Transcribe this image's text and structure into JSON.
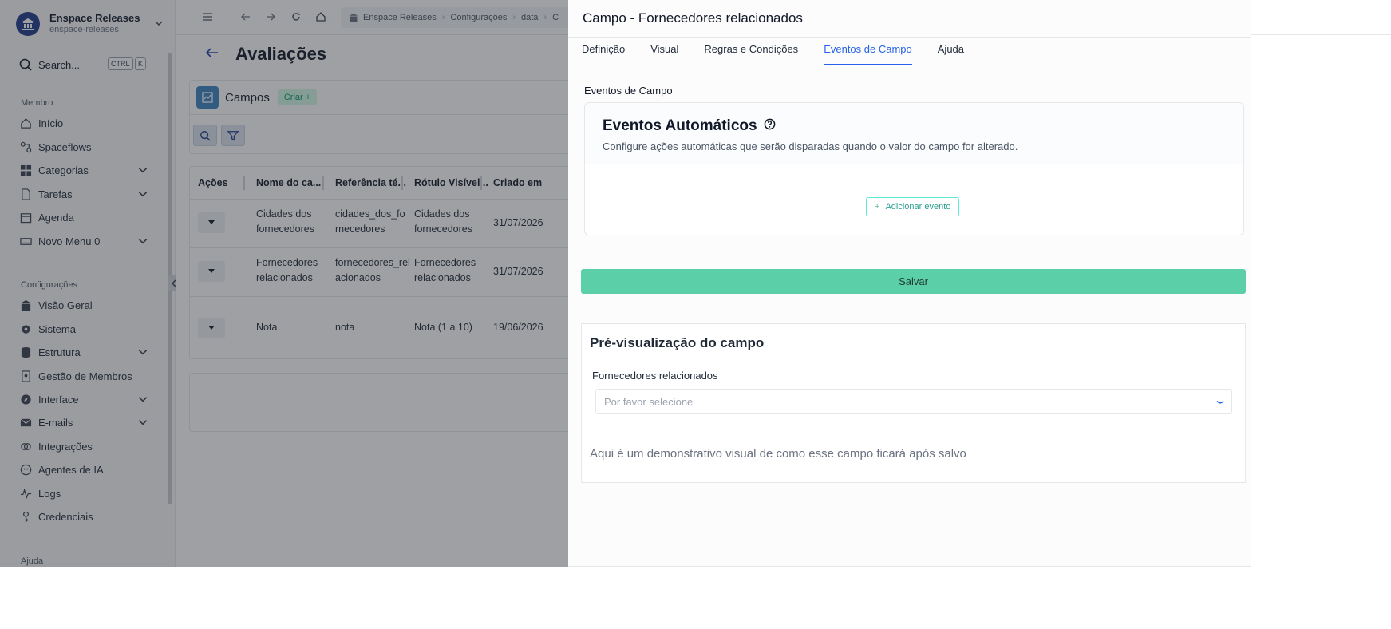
{
  "workspace": {
    "name": "Enspace Releases",
    "slug": "enspace-releases"
  },
  "search": {
    "label": "Search...",
    "kbd1": "CTRL",
    "kbd2": "K"
  },
  "sidebar": {
    "member_label": "Membro",
    "member_items": [
      {
        "label": "Início"
      },
      {
        "label": "Spaceflows"
      },
      {
        "label": "Categorias"
      },
      {
        "label": "Tarefas"
      },
      {
        "label": "Agenda"
      },
      {
        "label": "Novo Menu 0"
      }
    ],
    "config_label": "Configurações",
    "config_items": [
      {
        "label": "Visão Geral"
      },
      {
        "label": "Sistema"
      },
      {
        "label": "Estrutura"
      },
      {
        "label": "Gestão de Membros"
      },
      {
        "label": "Interface"
      },
      {
        "label": "E-mails"
      },
      {
        "label": "Integrações"
      },
      {
        "label": "Agentes de IA"
      },
      {
        "label": "Logs"
      },
      {
        "label": "Credenciais"
      }
    ],
    "help_label": "Ajuda"
  },
  "breadcrumb": [
    "Enspace Releases",
    "Configurações",
    "data",
    "C"
  ],
  "page": {
    "title": "Avaliações"
  },
  "fields_card": {
    "title": "Campos",
    "create_label": "Criar +"
  },
  "table": {
    "headers": [
      "Ações",
      "Nome do ca...",
      "Referência té...",
      "Rótulo Visível...",
      "Criado em"
    ],
    "rows": [
      {
        "name": "Cidades dos fornecedores",
        "ref": "cidades_dos_fornecedores",
        "label": "Cidades dos fornecedores",
        "created": "31/07/2026"
      },
      {
        "name": "Fornecedores relacionados",
        "ref": "fornecedores_relacionados",
        "label": "Fornecedores relacionados",
        "created": "31/07/2026"
      },
      {
        "name": "Nota",
        "ref": "nota",
        "label": "Nota (1 a 10)",
        "created": "19/06/2026"
      }
    ]
  },
  "drawer": {
    "title": "Campo - Fornecedores relacionados",
    "tabs": [
      {
        "label": "Definição",
        "active": false
      },
      {
        "label": "Visual",
        "active": false
      },
      {
        "label": "Regras e Condições",
        "active": false
      },
      {
        "label": "Eventos de Campo",
        "active": true
      },
      {
        "label": "Ajuda",
        "active": false
      }
    ],
    "section_label": "Eventos de Campo",
    "events": {
      "title": "Eventos Automáticos",
      "description": "Configure ações automáticas que serão disparadas quando o valor do campo for alterado.",
      "add_label": "Adicionar evento"
    },
    "save_label": "Salvar",
    "preview": {
      "title": "Pré-visualização do campo",
      "field_label": "Fornecedores relacionados",
      "placeholder": "Por favor selecione",
      "note": "Aqui é um demonstrativo visual de como esse campo ficará após salvo"
    }
  },
  "colors": {
    "accent": "#2563eb",
    "save": "#5acfa8",
    "brand": "#1e3a8a"
  }
}
